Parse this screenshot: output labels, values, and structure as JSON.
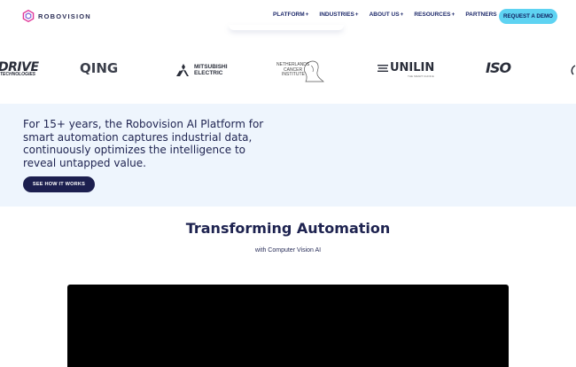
{
  "header": {
    "brand_name": "ROBOVISION",
    "nav": [
      {
        "label": "PLATFORM",
        "has_plus": true
      },
      {
        "label": "INDUSTRIES",
        "has_plus": true
      },
      {
        "label": "ABOUT US",
        "has_plus": true
      },
      {
        "label": "RESOURCES",
        "has_plus": true
      },
      {
        "label": "PARTNERS",
        "has_plus": false
      }
    ],
    "cta_label": "REQUEST A DEMO",
    "plus_symbol": "+"
  },
  "logos": {
    "drive": "DRIVE",
    "drive_sub": "TECHNOLOGIES",
    "qing": "QING",
    "mitsubishi_line1": "MITSUBISHI",
    "mitsubishi_line2": "ELECTRIC",
    "nki_line1": "NETHERLANDS",
    "nki_line2": "CANCER",
    "nki_line3": "INSTITUTE",
    "unilin": "UNILIN",
    "unilin_sub": "THE SMART CHOICE",
    "iso": "ISO"
  },
  "hero": {
    "text": "For 15+ years, the Robovision AI Platform for smart automation captures industrial data, continuously optimizes the intelligence to reveal untapped value.",
    "button_label": "SEE HOW IT WORKS"
  },
  "section": {
    "title": "Transforming Automation",
    "subtitle": "with Computer Vision AI"
  },
  "colors": {
    "accent": "#5ed3f2",
    "navy": "#1c1f4f",
    "hero_bg": "#eef5fd",
    "logo_pink": "#e0389a"
  }
}
